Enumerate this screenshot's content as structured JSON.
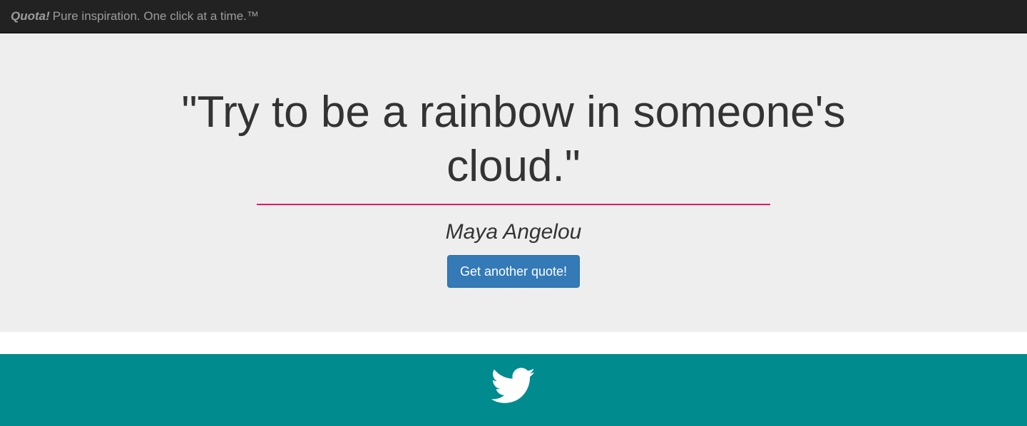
{
  "navbar": {
    "brand_name": "Quota!",
    "tagline": "Pure inspiration. One click at a time.™"
  },
  "quote": {
    "text": "\"Try to be a rainbow in someone's cloud.\"",
    "author": "Maya Angelou"
  },
  "actions": {
    "new_quote_label": "Get another quote!"
  },
  "footer": {
    "share_icon": "twitter-bird-icon"
  },
  "colors": {
    "navbar_bg": "#222222",
    "brand_text": "#9d9d9d",
    "jumbotron_bg": "#eeeeee",
    "quote_text": "#333333",
    "divider": "#e0196e",
    "button_bg": "#337ab7",
    "footer_bg": "#008b8f",
    "icon": "#ffffff"
  }
}
